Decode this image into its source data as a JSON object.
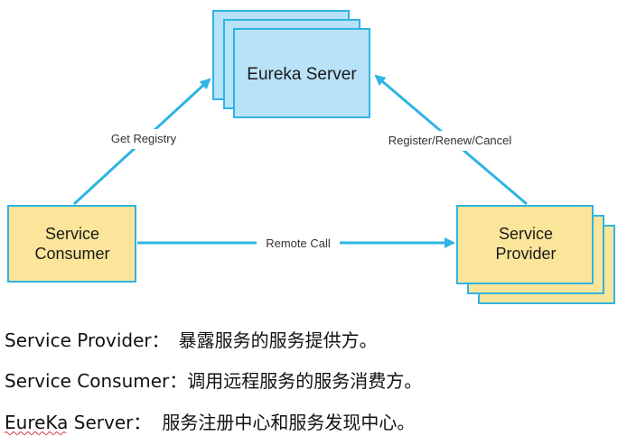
{
  "diagram": {
    "nodes": {
      "eureka_server": {
        "label": "Eureka Server",
        "fill": "#b8e2f7",
        "stroke": "#2fb4e3"
      },
      "service_consumer": {
        "label_line1": "Service",
        "label_line2": "Consumer",
        "fill": "#fbe59a",
        "stroke": "#2fb4e3"
      },
      "service_provider": {
        "label_line1": "Service",
        "label_line2": "Provider",
        "fill": "#fbe59a",
        "stroke": "#2fb4e3"
      }
    },
    "edges": {
      "get_registry": "Get Registry",
      "register_renew_cancel": "Register/Renew/Cancel",
      "remote_call": "Remote Call"
    },
    "arrow_color": "#2fb4e3"
  },
  "descriptions": [
    {
      "term": "Service Provider：",
      "definition": "暴露服务的服务提供方。"
    },
    {
      "term": "Service Consumer：",
      "definition": "调用远程服务的服务消费方。"
    },
    {
      "term": "EureKa Server：",
      "definition": "服务注册中心和服务发现中心。"
    }
  ]
}
